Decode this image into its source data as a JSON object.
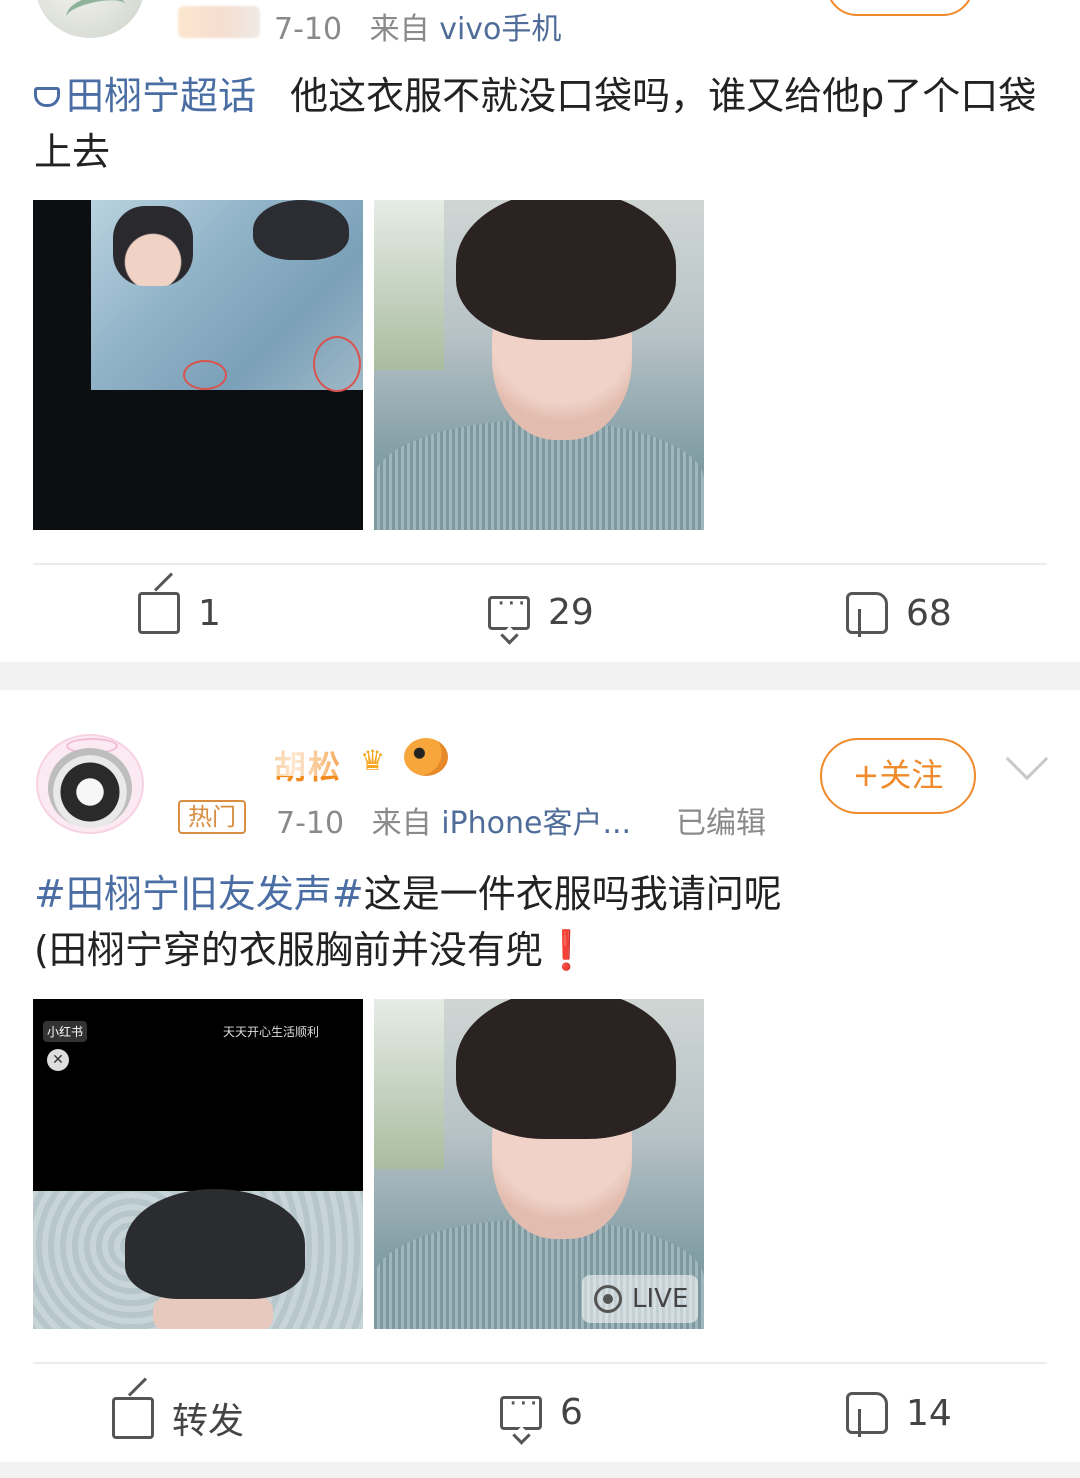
{
  "post1": {
    "date": "7-10",
    "source_prefix": "来自",
    "source": "vivo手机",
    "topic": "田栩宁超话",
    "text": "他这衣服不就没口袋吗，谁又给他p了个口袋上去",
    "actions": {
      "share": "1",
      "comments": "29",
      "likes": "68"
    }
  },
  "post2": {
    "username": "胡松",
    "hot_badge": "热门",
    "date": "7-10",
    "source_prefix": "来自",
    "source": "iPhone客户...",
    "edited": "已编辑",
    "follow_label": "+关注",
    "topic": "#田栩宁旧友发声#",
    "text_line1": "这是一件衣服吗我请问呢",
    "text_line2": "(田栩宁穿的衣服胸前并没有兜",
    "exclamation": "❗",
    "image_badge": "小红书",
    "image_caption": "天天开心生活顺利",
    "live_label": "LIVE",
    "actions": {
      "share": "转发",
      "comments": "6",
      "likes": "14"
    }
  }
}
